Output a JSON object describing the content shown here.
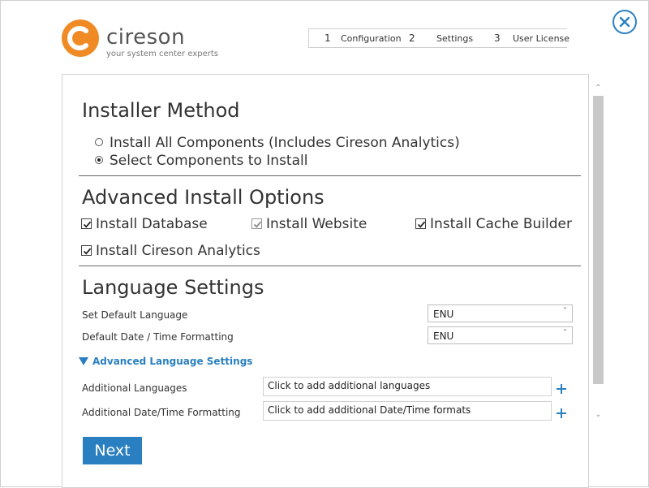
{
  "brand": {
    "name": "cireson",
    "tagline": "your system center experts",
    "accent": "#2a7fc1",
    "logo_orange": "#f08a24"
  },
  "wizard_steps": [
    {
      "num": "1",
      "label": "Configuration"
    },
    {
      "num": "2",
      "label": "Settings"
    },
    {
      "num": "3",
      "label": "User License"
    }
  ],
  "installer_method": {
    "title": "Installer Method",
    "options": [
      {
        "label": "Install All Components (Includes Cireson Analytics)",
        "selected": false
      },
      {
        "label": "Select Components to Install",
        "selected": true
      }
    ]
  },
  "advanced_options": {
    "title": "Advanced Install Options",
    "items": [
      {
        "label": "Install Database",
        "checked": true,
        "disabled": false
      },
      {
        "label": "Install Website",
        "checked": true,
        "disabled": true
      },
      {
        "label": "Install Cache Builder",
        "checked": true,
        "disabled": false
      },
      {
        "label": "Install Cireson Analytics",
        "checked": true,
        "disabled": false
      }
    ]
  },
  "language_settings": {
    "title": "Language Settings",
    "default_language_label": "Set  Default Language",
    "default_language_value": "ENU",
    "date_format_label": "Default Date / Time Formatting",
    "date_format_value": "ENU",
    "advanced_link": "Advanced Language Settings",
    "additional_languages_label": "Additional Languages",
    "additional_languages_value": "Click to add additional languages",
    "additional_formats_label": "Additional Date/Time Formatting",
    "additional_formats_value": "Click to add additional Date/Time formats"
  },
  "next_label": "Next"
}
